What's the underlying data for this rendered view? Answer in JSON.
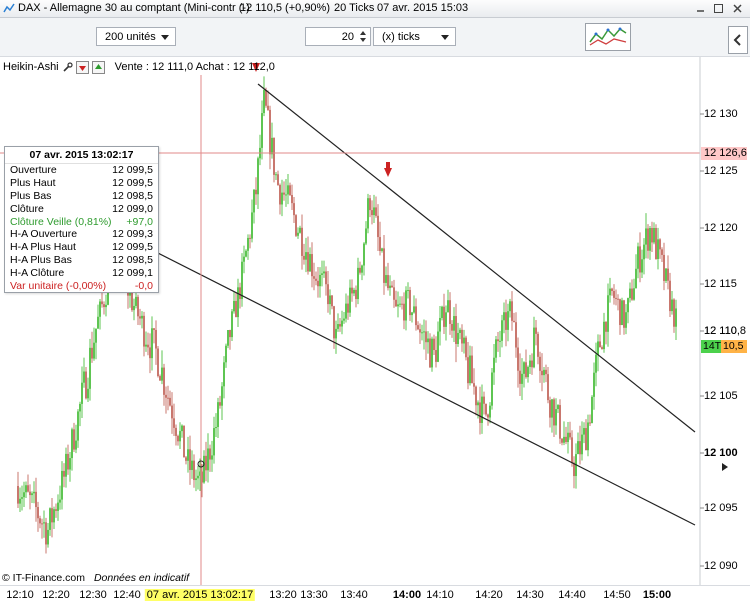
{
  "window": {
    "title": "DAX - Allemagne 30 au comptant (Mini-contr (-)",
    "price_change": "12 110,5 (+0,90%)",
    "ticks": "20 Ticks",
    "datetime": "07 avr. 2015 15:03"
  },
  "toolbar": {
    "units_value": "200 unités",
    "ticks_count": "20",
    "ticks_unit": "(x) ticks"
  },
  "header": {
    "indicator": "Heikin-Ashi",
    "vente_achat": "Vente : 12 111,0 Achat : 12 112,0"
  },
  "tooltip": {
    "title": "07 avr. 2015 13:02:17",
    "rows": [
      {
        "k": "Ouverture",
        "v": "12 099,5",
        "color": "#000000"
      },
      {
        "k": "Plus Haut",
        "v": "12 099,5",
        "color": "#000000"
      },
      {
        "k": "Plus Bas",
        "v": "12 098,5",
        "color": "#000000"
      },
      {
        "k": "Clôture",
        "v": "12 099,0",
        "color": "#000000"
      },
      {
        "k": "Clôture Veille (0,81%)",
        "v": "+97,0",
        "color": "#2e9b2e"
      },
      {
        "k": "H-A Ouverture",
        "v": "12 099,3",
        "color": "#000000"
      },
      {
        "k": "H-A Plus Haut",
        "v": "12 099,5",
        "color": "#000000"
      },
      {
        "k": "H-A Plus Bas",
        "v": "12 098,5",
        "color": "#000000"
      },
      {
        "k": "H-A Clôture",
        "v": "12 099,1",
        "color": "#000000"
      },
      {
        "k": "Var unitaire (-0,00%)",
        "v": "-0,0",
        "color": "#cc2222"
      }
    ]
  },
  "price_labels": {
    "crosshair": "12 126,6",
    "current": "12 110,8",
    "ticks_label": "14T",
    "ticks_value": "10,5"
  },
  "footer": {
    "brand": "© IT-Finance.com",
    "note": "Données en indicatif"
  },
  "colors": {
    "up": "#5ec552",
    "down": "#c9776e",
    "crosshair": "#e28a8a",
    "highlight": "#ffff66",
    "green_label": "#4cd14c",
    "orange_label": "#ffb347"
  },
  "chart_data": {
    "type": "candlestick",
    "y_ticks": [
      "12 090",
      "12 095",
      "12 100",
      "12 105",
      "12 110",
      "12 115",
      "12 120",
      "12 125",
      "12 130"
    ],
    "y_tick_values": [
      12090,
      12095,
      12100,
      12105,
      12110,
      12115,
      12120,
      12125,
      12130
    ],
    "bold_y_tick": "12 100",
    "x_labels": [
      "12:10",
      "12:20",
      "12:30",
      "12:40",
      "07 avr. 2015 13:02:17",
      "13:20",
      "13:30",
      "13:40",
      "14:00",
      "14:10",
      "14:20",
      "14:30",
      "14:40",
      "14:50",
      "15:00"
    ],
    "bold_x_labels": [
      "14:00",
      "15:00"
    ],
    "ylim": [
      12088,
      12135
    ],
    "crosshair_price": 12126.6,
    "current_price": 12110.8,
    "path": [
      {
        "t": 0,
        "p": 12097
      },
      {
        "t": 4,
        "p": 12095
      },
      {
        "t": 7,
        "p": 12093
      },
      {
        "t": 11,
        "p": 12098
      },
      {
        "t": 14,
        "p": 12103
      },
      {
        "t": 17,
        "p": 12108
      },
      {
        "t": 20,
        "p": 12113
      },
      {
        "t": 23,
        "p": 12118
      },
      {
        "t": 27,
        "p": 12113
      },
      {
        "t": 30,
        "p": 12110
      },
      {
        "t": 33,
        "p": 12108
      },
      {
        "t": 37,
        "p": 12103
      },
      {
        "t": 40,
        "p": 12099
      },
      {
        "t": 43,
        "p": 12097
      },
      {
        "t": 47,
        "p": 12103
      },
      {
        "t": 50,
        "p": 12110
      },
      {
        "t": 53,
        "p": 12116
      },
      {
        "t": 56,
        "p": 12123
      },
      {
        "t": 58,
        "p": 12131
      },
      {
        "t": 61,
        "p": 12124
      },
      {
        "t": 64,
        "p": 12122
      },
      {
        "t": 67,
        "p": 12119
      },
      {
        "t": 70,
        "p": 12116
      },
      {
        "t": 73,
        "p": 12114
      },
      {
        "t": 75,
        "p": 12109
      },
      {
        "t": 77,
        "p": 12112
      },
      {
        "t": 80,
        "p": 12115
      },
      {
        "t": 83,
        "p": 12123
      },
      {
        "t": 86,
        "p": 12116
      },
      {
        "t": 89,
        "p": 12112
      },
      {
        "t": 92,
        "p": 12113
      },
      {
        "t": 95,
        "p": 12110
      },
      {
        "t": 98,
        "p": 12108
      },
      {
        "t": 101,
        "p": 12113
      },
      {
        "t": 104,
        "p": 12109
      },
      {
        "t": 107,
        "p": 12106
      },
      {
        "t": 110,
        "p": 12103
      },
      {
        "t": 113,
        "p": 12109
      },
      {
        "t": 116,
        "p": 12112
      },
      {
        "t": 119,
        "p": 12106
      },
      {
        "t": 122,
        "p": 12110
      },
      {
        "t": 125,
        "p": 12105
      },
      {
        "t": 128,
        "p": 12102
      },
      {
        "t": 131,
        "p": 12099
      },
      {
        "t": 134,
        "p": 12102
      },
      {
        "t": 137,
        "p": 12109
      },
      {
        "t": 140,
        "p": 12114
      },
      {
        "t": 143,
        "p": 12111
      },
      {
        "t": 146,
        "p": 12117
      },
      {
        "t": 149,
        "p": 12120
      },
      {
        "t": 152,
        "p": 12116
      },
      {
        "t": 155,
        "p": 12111
      }
    ]
  }
}
